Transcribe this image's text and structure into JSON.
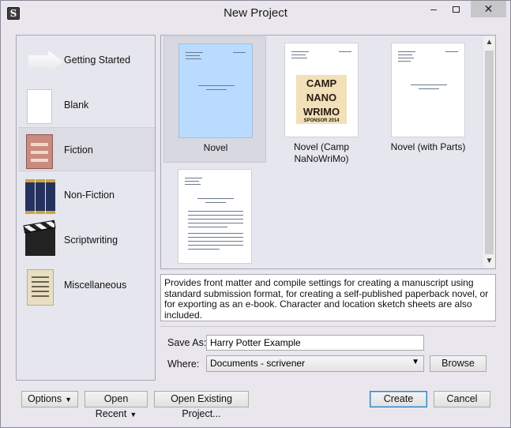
{
  "window": {
    "title": "New Project",
    "app_icon": "S",
    "controls": {
      "minimize": "‒",
      "close": "✕"
    }
  },
  "categories": [
    {
      "label": "Getting Started",
      "icon": "arrow-icon"
    },
    {
      "label": "Blank",
      "icon": "blank-page-icon"
    },
    {
      "label": "Fiction",
      "icon": "fiction-book-icon",
      "selected": true
    },
    {
      "label": "Non-Fiction",
      "icon": "books-icon"
    },
    {
      "label": "Scriptwriting",
      "icon": "clapperboard-icon"
    },
    {
      "label": "Miscellaneous",
      "icon": "notepaper-icon"
    }
  ],
  "templates": [
    {
      "label": "Novel",
      "selected": true
    },
    {
      "label": "Novel (Camp NaNoWriMo)",
      "thumbnail_text": [
        "CAMP",
        "NANO",
        "WRIMO"
      ],
      "thumbnail_subtext": "SPONSOR 2014"
    },
    {
      "label": "Novel (with Parts)"
    },
    {
      "label": ""
    }
  ],
  "description": "Provides front matter and compile settings for creating a manuscript using standard submission format, for creating a self-published paperback novel, or for exporting as an e-book. Character and location sketch sheets are also included.",
  "form": {
    "save_as_label": "Save As:",
    "save_as_value": "Harry Potter Example",
    "where_label": "Where:",
    "where_value": "Documents - scrivener",
    "browse": "Browse"
  },
  "buttons": {
    "options": "Options",
    "open_recent": "Open Recent",
    "open_existing": "Open Existing Project...",
    "create": "Create",
    "cancel": "Cancel"
  },
  "colors": {
    "selected_template": "#b9dbff",
    "window_bg": "#e9e6ee",
    "default_button_border": "#3c7fb1"
  }
}
